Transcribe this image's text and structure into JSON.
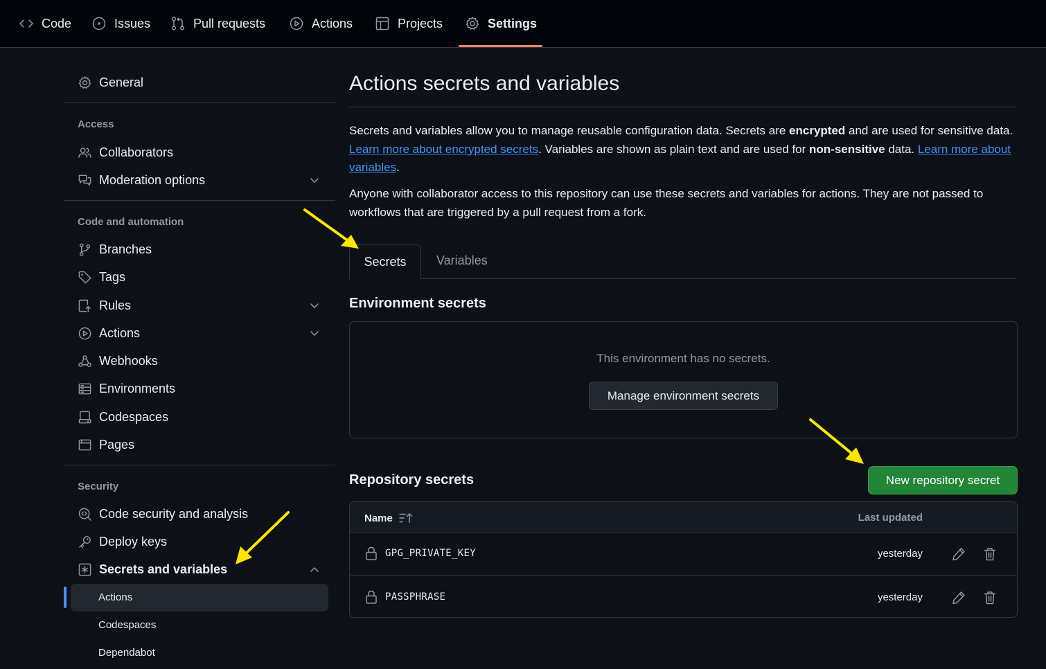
{
  "topnav": {
    "items": [
      {
        "label": "Code",
        "icon": "code-icon"
      },
      {
        "label": "Issues",
        "icon": "issue-icon"
      },
      {
        "label": "Pull requests",
        "icon": "pull-request-icon"
      },
      {
        "label": "Actions",
        "icon": "play-icon"
      },
      {
        "label": "Projects",
        "icon": "table-icon"
      },
      {
        "label": "Settings",
        "icon": "gear-icon"
      }
    ],
    "active": "Settings"
  },
  "sidebar": {
    "general": "General",
    "sections": {
      "access": "Access",
      "automation": "Code and automation",
      "security": "Security"
    },
    "items": {
      "collaborators": "Collaborators",
      "moderation": "Moderation options",
      "branches": "Branches",
      "tags": "Tags",
      "rules": "Rules",
      "actions": "Actions",
      "webhooks": "Webhooks",
      "environments": "Environments",
      "codespaces": "Codespaces",
      "pages": "Pages",
      "code_security": "Code security and analysis",
      "deploy_keys": "Deploy keys",
      "secrets": "Secrets and variables"
    },
    "sub_items": [
      "Actions",
      "Codespaces",
      "Dependabot"
    ],
    "active_sub": "Actions"
  },
  "main": {
    "title": "Actions secrets and variables",
    "intro": {
      "t1": "Secrets and variables allow you to manage reusable configuration data. Secrets are ",
      "b1": "encrypted",
      "t2": " and are used for sensitive data. ",
      "link1": "Learn more about encrypted secrets",
      "t3": ". Variables are shown as plain text and are used for ",
      "b2": "non-sensitive",
      "t4": " data. ",
      "link2": "Learn more about variables",
      "t5": "."
    },
    "note": "Anyone with collaborator access to this repository can use these secrets and variables for actions. They are not passed to workflows that are triggered by a pull request from a fork.",
    "tabs": [
      "Secrets",
      "Variables"
    ],
    "active_tab": "Secrets",
    "env_secrets": {
      "heading": "Environment secrets",
      "empty": "This environment has no secrets.",
      "button": "Manage environment secrets"
    },
    "repo_secrets": {
      "heading": "Repository secrets",
      "new_button": "New repository secret",
      "columns": {
        "name": "Name",
        "updated": "Last updated"
      },
      "rows": [
        {
          "name": "GPG_PRIVATE_KEY",
          "updated": "yesterday"
        },
        {
          "name": "PASSPHRASE",
          "updated": "yesterday"
        }
      ]
    }
  },
  "colors": {
    "accent": "#f78166",
    "link": "#4493f8",
    "primary_button": "#238636",
    "annotation_arrow": "#ffe600"
  }
}
